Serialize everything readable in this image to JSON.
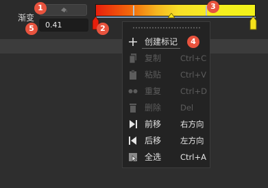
{
  "gradient_panel": {
    "label": "渐变",
    "value": "0.41",
    "color_stop_left": "#e81f0c",
    "color_stop_right": "#f2f21a",
    "stop_marker_color_left": "#e81f0c",
    "stop_marker_color_right": "#f5e21a",
    "midpoint_marker_color": "#f5e21a"
  },
  "callouts": {
    "c1": "1",
    "c2": "2",
    "c3": "3",
    "c4": "4",
    "c5": "5"
  },
  "context_menu": {
    "items": [
      {
        "label": "创建标记",
        "shortcut": "",
        "icon": "plus-icon",
        "enabled": true
      },
      {
        "label": "复制",
        "shortcut": "Ctrl+C",
        "icon": "copy-icon",
        "enabled": false
      },
      {
        "label": "粘贴",
        "shortcut": "Ctrl+V",
        "icon": "paste-icon",
        "enabled": false
      },
      {
        "label": "重复",
        "shortcut": "Ctrl+D",
        "icon": "duplicate-icon",
        "enabled": false
      },
      {
        "label": "删除",
        "shortcut": "Del",
        "icon": "trash-icon",
        "enabled": false
      },
      {
        "label": "前移",
        "shortcut": "右方向",
        "icon": "move-forward-icon",
        "enabled": true
      },
      {
        "label": "后移",
        "shortcut": "左方向",
        "icon": "move-back-icon",
        "enabled": true
      },
      {
        "label": "全选",
        "shortcut": "Ctrl+A",
        "icon": "select-all-icon",
        "enabled": true
      }
    ]
  }
}
